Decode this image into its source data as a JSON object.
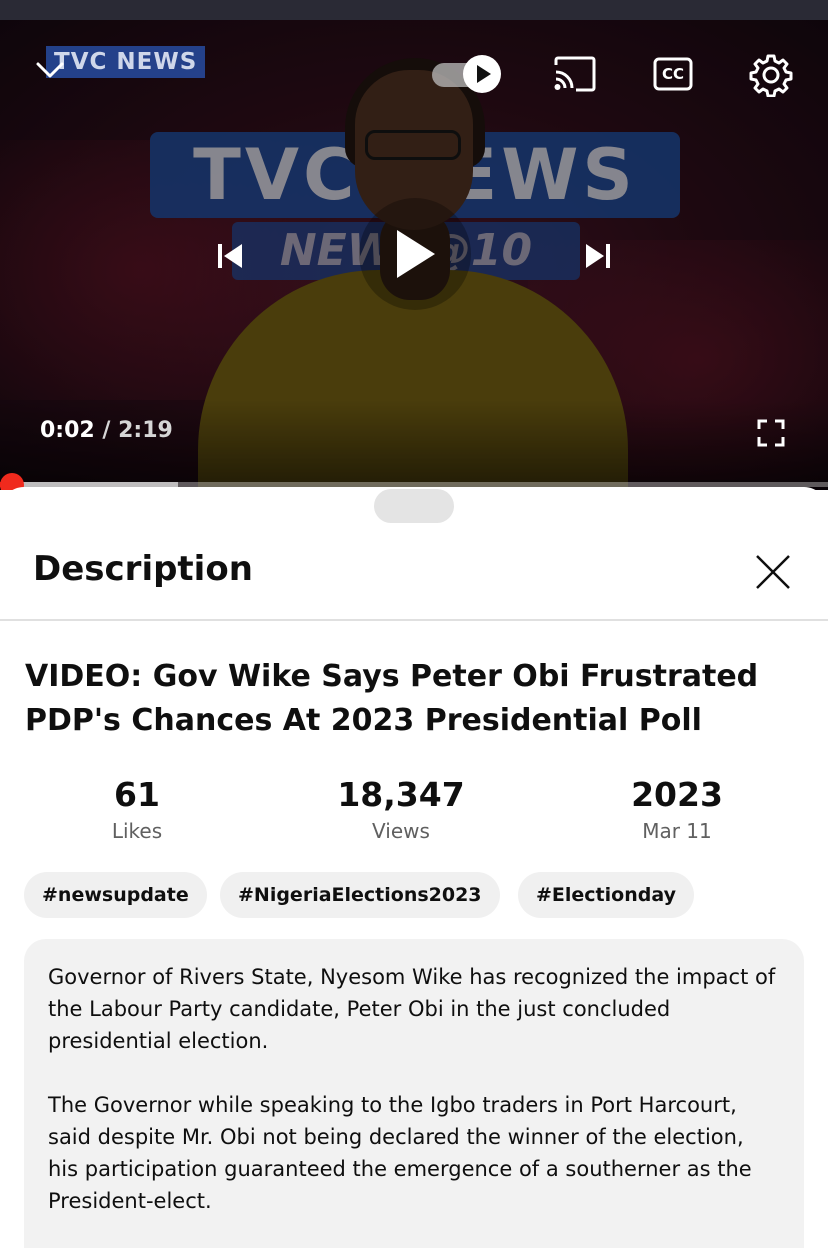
{
  "player": {
    "channel_logo": "TVC NEWS",
    "current_time": "0:02",
    "separator": " / ",
    "duration": "2:19",
    "progress_fraction": 0.014,
    "buffered_fraction": 0.215,
    "icons": {
      "collapse": "chevron-down-icon",
      "autoplay": "autoplay-toggle-icon",
      "cast": "cast-icon",
      "captions": "closed-captions-icon",
      "settings": "gear-icon",
      "previous": "skip-previous-icon",
      "play": "play-icon",
      "next": "skip-next-icon",
      "fullscreen": "fullscreen-icon"
    },
    "captions_label": "CC",
    "backdrop": {
      "line1": "TVC NEWS",
      "line2": "NEWS@10"
    }
  },
  "sheet": {
    "title": "Description",
    "close_icon": "close-icon",
    "video_title": "VIDEO: Gov Wike Says Peter Obi Frustrated PDP's Chances At 2023 Presidential Poll",
    "stats": {
      "likes": {
        "value": "61",
        "label": "Likes"
      },
      "views": {
        "value": "18,347",
        "label": "Views"
      },
      "date": {
        "value": "2023",
        "label": "Mar 11"
      }
    },
    "hashtags": [
      "#newsupdate",
      "#NigeriaElections2023",
      "#Electionday"
    ],
    "description": [
      "Governor of Rivers State, Nyesom Wike has recognized the impact of the Labour Party candidate, Peter Obi in the just concluded presidential election.",
      "The Governor while speaking to the Igbo traders in Port Harcourt, said despite Mr. Obi not being declared the winner of the election, his participation guaranteed the emergence of a southerner as the President-elect."
    ]
  },
  "colors": {
    "progress_played": "#ff0000",
    "chip_bg": "#f0f0f0",
    "description_bg": "#f2f2f2",
    "secondary_text": "#606060"
  }
}
